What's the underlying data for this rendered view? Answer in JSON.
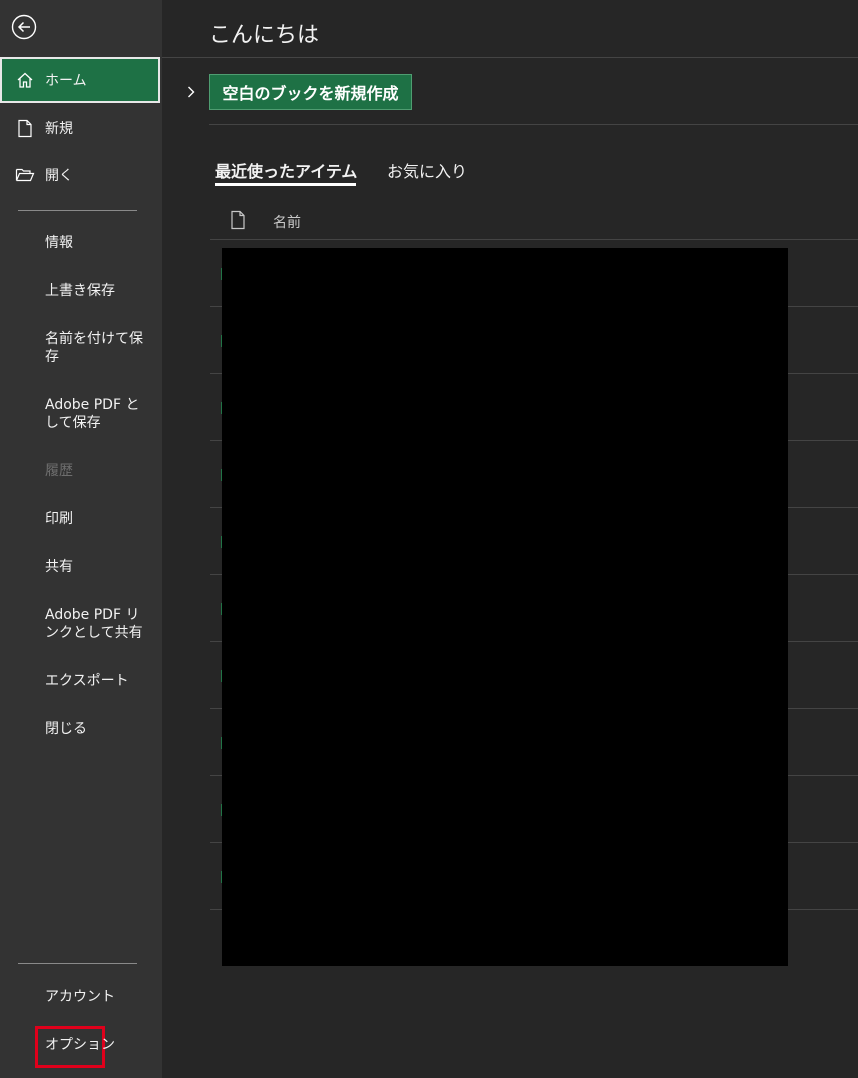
{
  "sidebar": {
    "back_label": "戻る",
    "primary": [
      {
        "label": "ホーム",
        "icon": "home-icon"
      },
      {
        "label": "新規",
        "icon": "new-document-icon"
      },
      {
        "label": "開く",
        "icon": "open-folder-icon"
      }
    ],
    "items": [
      {
        "label": "情報",
        "enabled": true
      },
      {
        "label": "上書き保存",
        "enabled": true
      },
      {
        "label": "名前を付けて保存",
        "enabled": true
      },
      {
        "label": "Adobe PDF として保存",
        "enabled": true
      },
      {
        "label": "履歴",
        "enabled": false
      },
      {
        "label": "印刷",
        "enabled": true
      },
      {
        "label": "共有",
        "enabled": true
      },
      {
        "label": "Adobe PDF リンクとして共有",
        "enabled": true
      },
      {
        "label": "エクスポート",
        "enabled": true
      },
      {
        "label": "閉じる",
        "enabled": true
      }
    ],
    "footer": [
      {
        "label": "アカウント"
      },
      {
        "label": "オプション",
        "highlighted": true
      }
    ]
  },
  "main": {
    "greeting": "こんにちは",
    "new_blank_label": "空白のブックを新規作成",
    "tabs": [
      {
        "label": "最近使ったアイテム",
        "active": true
      },
      {
        "label": "お気に入り",
        "active": false
      }
    ],
    "column_header": "名前"
  },
  "colors": {
    "accent": "#1e7145",
    "highlight_box": "#e0001b",
    "sidebar_bg": "#333333",
    "main_bg": "#262626"
  }
}
